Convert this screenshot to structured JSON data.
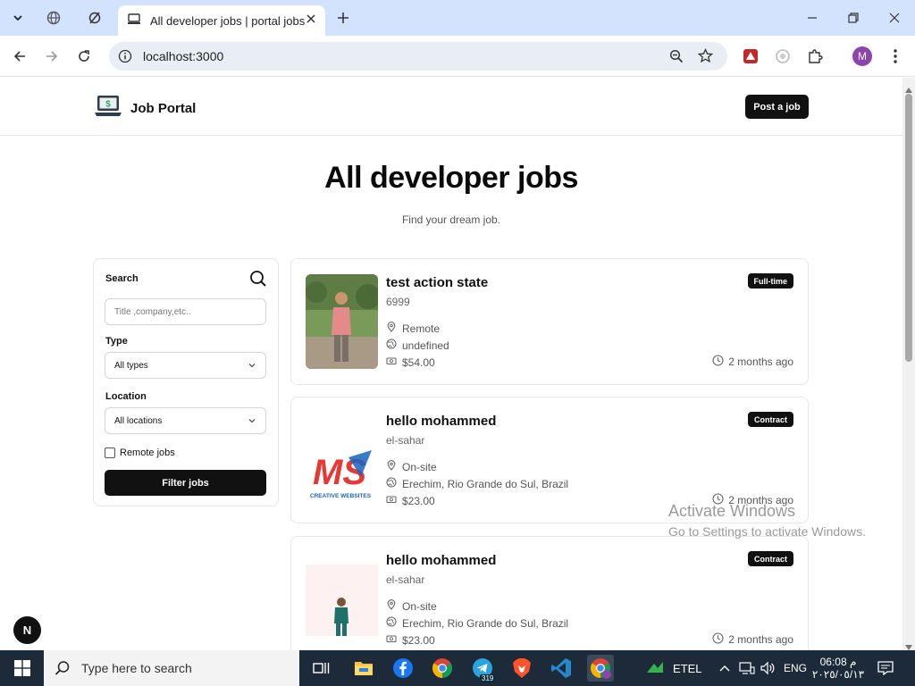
{
  "browser": {
    "tab_title": "All developer jobs | portal jobs",
    "url": "localhost:3000",
    "profile_initial": "M"
  },
  "header": {
    "logo_text": "Job Portal",
    "post_button": "Post a job"
  },
  "hero": {
    "title": "All developer jobs",
    "subtitle": "Find your dream job."
  },
  "filters": {
    "search_label": "Search",
    "search_placeholder": "Title ,company,etc..",
    "type_label": "Type",
    "type_value": "All types",
    "location_label": "Location",
    "location_value": "All locations",
    "remote_label": "Remote jobs",
    "remote_checked": false,
    "submit_label": "Filter jobs"
  },
  "jobs": [
    {
      "title": "test action state",
      "company": "6999",
      "location_type": "Remote",
      "location": "undefined",
      "salary": "$54.00",
      "type": "Full-time",
      "posted": "2 months ago"
    },
    {
      "title": "hello mohammed",
      "company": "el-sahar",
      "location_type": "On-site",
      "location": "Erechim, Rio Grande do Sul, Brazil",
      "salary": "$23.00",
      "type": "Contract",
      "posted": "2 months ago"
    },
    {
      "title": "hello mohammed",
      "company": "el-sahar",
      "location_type": "On-site",
      "location": "Erechim, Rio Grande do Sul, Brazil",
      "salary": "$23.00",
      "type": "Contract",
      "posted": "2 months ago"
    }
  ],
  "logo2": {
    "letters": "MS",
    "caption": "CREATIVE WEBSITES"
  },
  "watermark": {
    "line1": "Activate Windows",
    "line2": "Go to Settings to activate Windows."
  },
  "dev_badge": "N",
  "taskbar": {
    "search_placeholder": "Type here to search",
    "telegram_count": "319",
    "network_label": "ETEL",
    "language": "ENG",
    "time": "06:08 م",
    "date": "٢٠٢٥/٠٥/١٣"
  }
}
